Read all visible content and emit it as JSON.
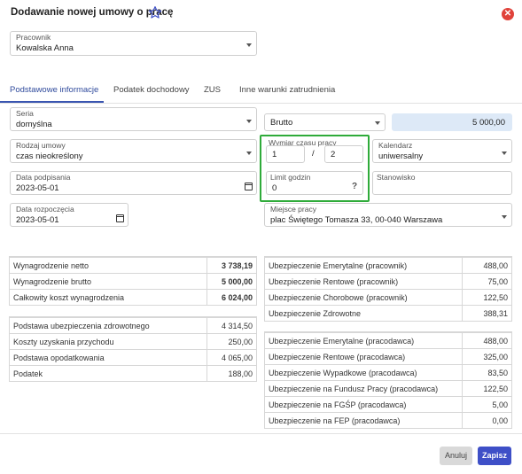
{
  "dialog": {
    "title": "Dodawanie nowej umowy o pracę",
    "star_icon": "star-outline-icon",
    "close_icon": "close-circle-icon"
  },
  "employee": {
    "label": "Pracownik",
    "value": "Kowalska Anna"
  },
  "tabs": [
    {
      "label": "Podstawowe informacje",
      "active": true
    },
    {
      "label": "Podatek dochodowy",
      "active": false
    },
    {
      "label": "ZUS",
      "active": false
    },
    {
      "label": "Inne warunki zatrudnienia",
      "active": false
    }
  ],
  "form": {
    "seria": {
      "label": "Seria",
      "value": "domyślna"
    },
    "pay_type": {
      "value": "Brutto"
    },
    "salary": {
      "value": "5 000,00"
    },
    "rodzaj": {
      "label": "Rodzaj umowy",
      "value": "czas nieokreślony"
    },
    "wymiar": {
      "label": "Wymiar czasu pracy",
      "numerator": "1",
      "separator": "/",
      "denominator": "2"
    },
    "kalendarz": {
      "label": "Kalendarz",
      "value": "uniwersalny"
    },
    "data_podpisania": {
      "label": "Data podpisania",
      "value": "2023-05-01"
    },
    "limit": {
      "label": "Limit godzin",
      "value": "0",
      "help": "?"
    },
    "stanowisko": {
      "label": "Stanowisko",
      "value": ""
    },
    "data_rozpoczecia": {
      "label": "Data rozpoczęcia",
      "value": "2023-05-01"
    },
    "miejsce": {
      "label": "Miejsce pracy",
      "value": "plac Świętego Tomasza  33, 00-040 Warszawa"
    }
  },
  "summary_left_top": [
    {
      "label": "Wynagrodzenie netto",
      "value": "3 738,19"
    },
    {
      "label": "Wynagrodzenie brutto",
      "value": "5 000,00"
    },
    {
      "label": "Całkowity koszt wynagrodzenia",
      "value": "6 024,00"
    }
  ],
  "summary_left_bottom": [
    {
      "label": "Podstawa ubezpieczenia zdrowotnego",
      "value": "4 314,50"
    },
    {
      "label": "Koszty uzyskania przychodu",
      "value": "250,00"
    },
    {
      "label": "Podstawa opodatkowania",
      "value": "4 065,00"
    },
    {
      "label": "Podatek",
      "value": "188,00"
    }
  ],
  "summary_right_top": [
    {
      "label": "Ubezpieczenie Emerytalne (pracownik)",
      "value": "488,00"
    },
    {
      "label": "Ubezpieczenie Rentowe (pracownik)",
      "value": "75,00"
    },
    {
      "label": "Ubezpieczenie Chorobowe (pracownik)",
      "value": "122,50"
    },
    {
      "label": "Ubezpieczenie Zdrowotne",
      "value": "388,31"
    }
  ],
  "summary_right_bottom": [
    {
      "label": "Ubezpieczenie Emerytalne (pracodawca)",
      "value": "488,00"
    },
    {
      "label": "Ubezpieczenie Rentowe (pracodawca)",
      "value": "325,00"
    },
    {
      "label": "Ubezpieczenie Wypadkowe (pracodawca)",
      "value": "83,50"
    },
    {
      "label": "Ubezpieczenie na Fundusz Pracy (pracodawca)",
      "value": "122,50"
    },
    {
      "label": "Ubezpieczenie na FGŚP (pracodawca)",
      "value": "5,00"
    },
    {
      "label": "Ubezpieczenie na FEP (pracodawca)",
      "value": "0,00"
    }
  ],
  "footer": {
    "cancel_label": "Anuluj",
    "save_label": "Zapisz"
  },
  "colors": {
    "accent": "#3e4fc7",
    "highlight": "#2fab3a",
    "close": "#e0423a",
    "salary_bg": "#dde9f7"
  }
}
